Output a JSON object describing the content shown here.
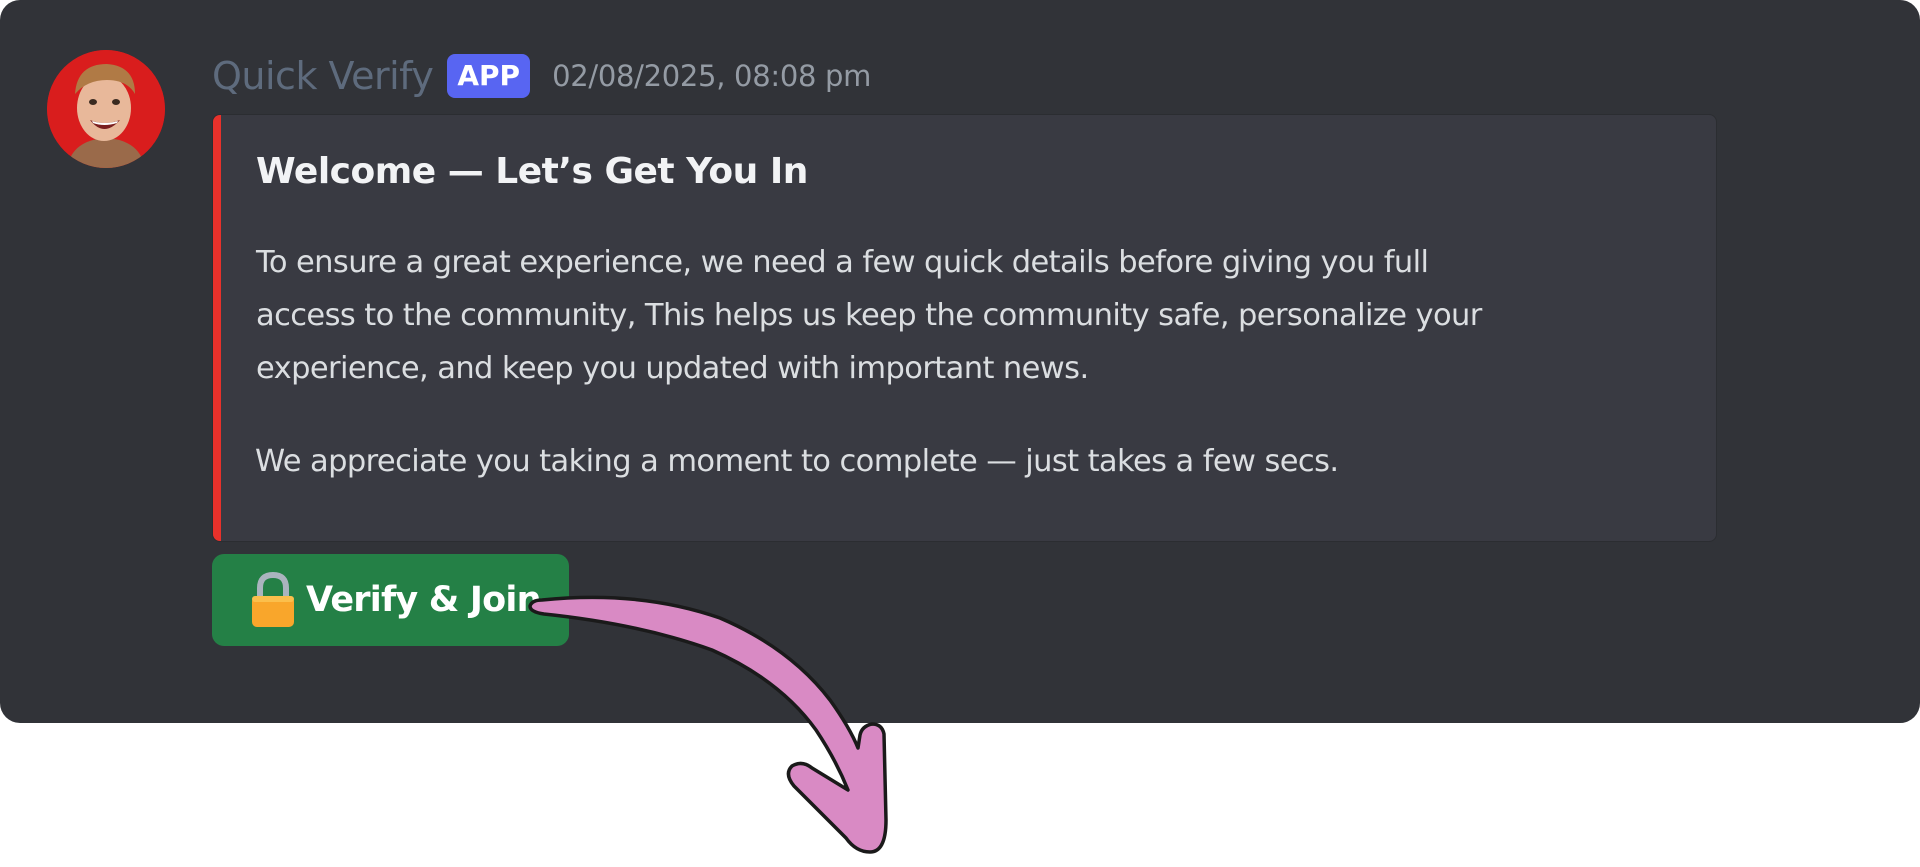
{
  "message": {
    "author": "Quick Verify",
    "badge": "APP",
    "timestamp": "02/08/2025, 08:08 pm",
    "avatar_icon": "user-avatar"
  },
  "embed": {
    "accent_color": "#e8312b",
    "title": "Welcome — Let’s Get You In",
    "description_lines": [
      "To ensure a great experience, we need a few quick details before giving you full",
      "access to the community, This helps us keep the community safe, personalize your",
      "experience, and keep you updated with important news."
    ],
    "note": "We appreciate you taking a moment to complete — just takes a few secs."
  },
  "button": {
    "icon": "lock-icon",
    "label": "Verify & Join",
    "color": "#248046"
  },
  "annotation": {
    "icon": "curved-arrow-icon",
    "color": "#d98ac4"
  }
}
